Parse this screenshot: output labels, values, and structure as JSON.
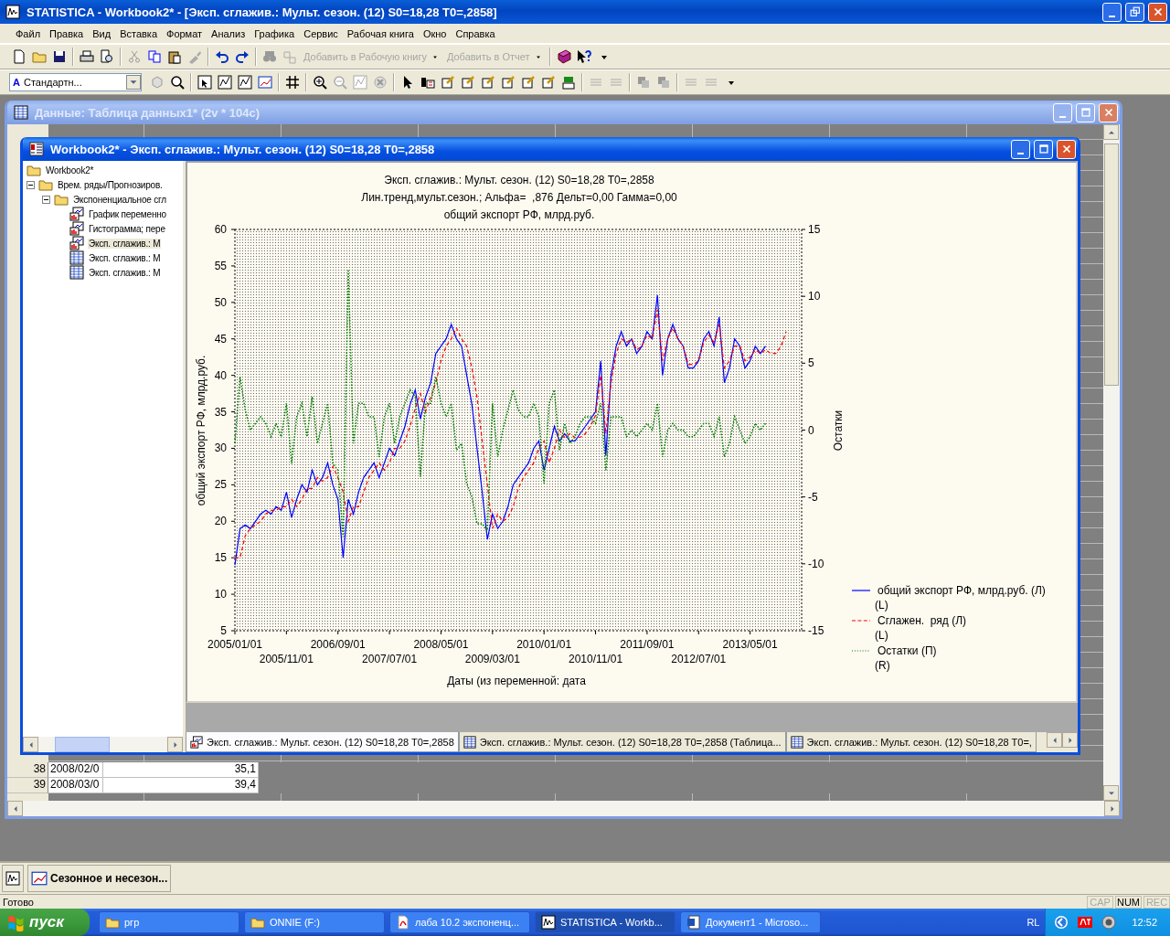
{
  "app": {
    "title": "STATISTICA - Workbook2* - [Эксп. сглажив.: Мульт. сезон. (12) S0=18,28 T0=,2858]"
  },
  "menu": [
    "Файл",
    "Правка",
    "Вид",
    "Вставка",
    "Формат",
    "Анализ",
    "Графика",
    "Сервис",
    "Рабочая книга",
    "Окно",
    "Справка"
  ],
  "toolbar": {
    "buttons": [
      {
        "label": "Добавить в Рабочую книгу",
        "disabled": true
      },
      {
        "label": "Добавить в Отчет",
        "disabled": true
      }
    ]
  },
  "format_bar": {
    "style_combo": {
      "glyph": "A",
      "value": "Стандартн..."
    }
  },
  "data_window": {
    "title": "Данные: Таблица данных1* (2v * 104c)",
    "active": false,
    "rows": [
      {
        "number": "38",
        "cells": [
          "2008/02/0",
          "35,1"
        ]
      },
      {
        "number": "39",
        "cells": [
          "2008/03/0",
          "39,4"
        ]
      }
    ]
  },
  "workbook": {
    "title": "Workbook2* - Эксп. сглажив.: Мульт. сезон. (12) S0=18,28 T0=,2858",
    "active": true,
    "tree": [
      {
        "label": "Workbook2*",
        "kind": "folder",
        "selected": false,
        "children": [
          {
            "label": "Врем. ряды/Прогнозиров.",
            "kind": "folder",
            "selected": false,
            "expanded": true,
            "children": [
              {
                "label": "Экспоненциальное сгл",
                "kind": "folder",
                "selected": false,
                "expanded": true,
                "children": [
                  {
                    "label": "График переменно",
                    "kind": "graph",
                    "selected": false
                  },
                  {
                    "label": "Гистограмма; пере",
                    "kind": "graph",
                    "selected": false
                  },
                  {
                    "label": "Эксп. сглажив.: М",
                    "kind": "graph",
                    "selected": true
                  },
                  {
                    "label": "Эксп. сглажив.: М",
                    "kind": "table",
                    "selected": false
                  },
                  {
                    "label": "Эксп. сглажив.: М",
                    "kind": "table",
                    "selected": false
                  }
                ]
              }
            ]
          }
        ]
      }
    ],
    "chart": {
      "subtitles": [
        "Лин.тренд,мульт.сезон.; Альфа=  ,876 Дельт=0,00 Гамма=0,00",
        "общий экспорт РФ, млрд.руб."
      ],
      "chart_data": {
        "type": "line",
        "title": "Эксп. сглажив.: Мульт. сезон. (12) S0=18,28 T0=,2858",
        "xlabel": "Даты (из переменной: дата",
        "ylabel": "общий экспорт РФ, млрд.руб.",
        "y2label": "Остатки",
        "categories": [
          "2005/01/01",
          null,
          null,
          null,
          null,
          null,
          null,
          null,
          null,
          null,
          "2005/11/01",
          null,
          null,
          null,
          null,
          null,
          null,
          null,
          null,
          null,
          "2006/09/01",
          null,
          null,
          null,
          null,
          null,
          null,
          null,
          null,
          null,
          "2007/07/01",
          null,
          null,
          null,
          null,
          null,
          null,
          null,
          null,
          null,
          "2008/05/01",
          null,
          null,
          null,
          null,
          null,
          null,
          null,
          null,
          null,
          "2009/03/01",
          null,
          null,
          null,
          null,
          null,
          null,
          null,
          null,
          null,
          "2010/01/01",
          null,
          null,
          null,
          null,
          null,
          null,
          null,
          null,
          null,
          "2010/11/01",
          null,
          null,
          null,
          null,
          null,
          null,
          null,
          null,
          null,
          "2011/09/01",
          null,
          null,
          null,
          null,
          null,
          null,
          null,
          null,
          null,
          "2012/07/01",
          null,
          null,
          null,
          null,
          null,
          null,
          null,
          null,
          null,
          "2013/05/01",
          null,
          null,
          null,
          null,
          null,
          null,
          null
        ],
        "legend": true,
        "ylim": [
          5,
          60
        ],
        "y2lim": [
          -15,
          15
        ],
        "yticks": [
          5,
          10,
          15,
          20,
          25,
          30,
          35,
          40,
          45,
          50,
          55,
          60
        ],
        "y2ticks": [
          -15,
          -10,
          -5,
          0,
          5,
          10,
          15
        ],
        "series": [
          {
            "name": "общий экспорт РФ, млрд.руб. (Л) (L)",
            "color": "#0000ff",
            "values": [
              14,
              19,
              19.5,
              19,
              20,
              21,
              21.5,
              21,
              22,
              21.5,
              24,
              20.5,
              23,
              25,
              24,
              27,
              25,
              26,
              28,
              25,
              23,
              15,
              23,
              21,
              24,
              26,
              27,
              28,
              26,
              28,
              30,
              29,
              31,
              33,
              36,
              38,
              34,
              37,
              39,
              43,
              44,
              45,
              47,
              45,
              44,
              40,
              36,
              30,
              24,
              17.5,
              21,
              19,
              20,
              22,
              25,
              26,
              27,
              28,
              30,
              31,
              27,
              30,
              33,
              31,
              32,
              31,
              31,
              32,
              33,
              34,
              35,
              42,
              29,
              40,
              44,
              46,
              44,
              45,
              43,
              44,
              46,
              45,
              51,
              40,
              45,
              47,
              45,
              44,
              41,
              41,
              42,
              45,
              46,
              44,
              48,
              39,
              41,
              45,
              44,
              41,
              42,
              44,
              43,
              44,
              null,
              null,
              null,
              null
            ]
          },
          {
            "name": "Сглажен.  ряд (Л) (L)",
            "color": "#ff0000",
            "line_style": "dashed",
            "values": [
              15,
              15,
              18,
              19,
              19.5,
              20,
              21,
              21.5,
              21.5,
              22,
              22,
              23,
              22,
              23,
              24.5,
              24.5,
              26,
              25.5,
              26,
              27.5,
              26,
              24,
              20,
              22,
              22,
              24,
              26,
              27,
              28,
              27,
              28,
              30,
              30,
              31,
              33,
              35.5,
              37.5,
              35,
              37,
              39,
              42,
              44,
              45,
              46.5,
              45,
              44,
              41,
              37,
              31,
              25,
              19,
              21,
              20,
              20.5,
              22,
              24.5,
              26,
              27,
              28,
              30,
              31,
              28,
              30,
              32.5,
              31.5,
              32,
              31.5,
              31.5,
              32,
              33,
              34.5,
              40,
              32,
              39,
              43,
              45,
              44.5,
              45,
              43.5,
              44,
              45.5,
              45,
              49,
              42,
              45,
              46.5,
              45,
              44,
              41.5,
              41.5,
              42,
              44.5,
              45.5,
              44.5,
              47,
              41,
              42,
              44,
              44,
              42,
              42.5,
              43.5,
              43,
              43.5,
              43,
              43,
              44,
              46
            ]
          },
          {
            "name": "Остатки (П) (R)",
            "color": "#008000",
            "line_style": "dotted",
            "axis": "y2",
            "values": [
              -1,
              4,
              1.5,
              0,
              0.5,
              1,
              0.5,
              -0.5,
              0.5,
              -0.5,
              2,
              -2.5,
              1,
              2,
              -0.5,
              2.5,
              -1,
              0.5,
              2,
              -2.5,
              -3,
              -8,
              12,
              -1,
              2,
              2,
              1,
              1,
              -2,
              1,
              2,
              -1,
              1,
              2,
              3,
              2.5,
              -3.5,
              2,
              2,
              4,
              2,
              1,
              2,
              -1.5,
              -1,
              -4,
              -5,
              -7,
              -7,
              -7.5,
              2,
              -2,
              0,
              1.5,
              3,
              1.5,
              1,
              1,
              2,
              1,
              -4,
              2,
              3,
              -1.5,
              0.5,
              -1,
              -0.5,
              0.5,
              1,
              1,
              0.5,
              2,
              -3,
              1,
              1,
              1,
              -0.5,
              0,
              -0.5,
              0,
              0.5,
              0,
              2,
              -2,
              0,
              0.5,
              0,
              0,
              -0.5,
              -0.5,
              0,
              0.5,
              0.5,
              -0.5,
              1,
              -2,
              -1,
              1,
              0,
              -1,
              -0.5,
              0.5,
              0,
              0.5,
              null,
              null,
              null,
              null
            ]
          }
        ]
      }
    },
    "tabs": [
      {
        "label": "Эксп. сглажив.: Мульт. сезон. (12) S0=18,28 T0=,2858",
        "kind": "graph",
        "selected": true
      },
      {
        "label": "Эксп. сглажив.: Мульт. сезон. (12) S0=18,28 T0=,2858 (Таблица...",
        "kind": "table",
        "selected": false
      },
      {
        "label": "Эксп. сглажив.: Мульт. сезон. (12) S0=18,28 T0=,",
        "kind": "table",
        "selected": false
      }
    ]
  },
  "minimized_windows": [
    {
      "kind": "icon"
    },
    {
      "kind": "labeled",
      "label": "Сезонное и несезон..."
    }
  ],
  "status_bar": {
    "text": "Готово",
    "indicators": [
      {
        "label": "CAP",
        "on": false
      },
      {
        "label": "NUM",
        "on": true
      },
      {
        "label": "REC",
        "on": false
      }
    ]
  },
  "taskbar": {
    "start": "пуск",
    "tasks": [
      {
        "label": "ргр",
        "kind": "folder",
        "selected": false
      },
      {
        "label": "ONNIE (F:)",
        "kind": "folder",
        "selected": false
      },
      {
        "label": "лаба 10.2 экспоненц...",
        "kind": "pdf",
        "selected": false
      },
      {
        "label": "STATISTICA - Workb...",
        "kind": "app",
        "selected": true
      },
      {
        "label": "Документ1 - Microso...",
        "kind": "word",
        "selected": false
      }
    ],
    "language": "RL",
    "clock": "12:52"
  }
}
